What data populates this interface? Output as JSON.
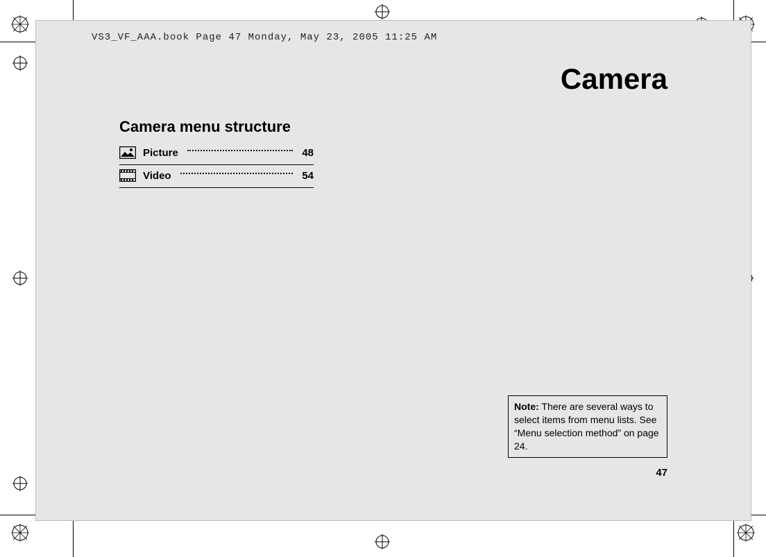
{
  "header": {
    "running_head": "VS3_VF_AAA.book  Page 47  Monday, May 23, 2005  11:25 AM"
  },
  "title": "Camera",
  "subheading": "Camera menu structure",
  "toc": [
    {
      "icon": "picture-icon",
      "label": "Picture",
      "page": "48"
    },
    {
      "icon": "video-icon",
      "label": "Video",
      "page": "54"
    }
  ],
  "note": {
    "prefix": "Note:",
    "body": " There are several ways to select items from menu lists. See “Menu selection method” on page 24."
  },
  "page_number": "47"
}
